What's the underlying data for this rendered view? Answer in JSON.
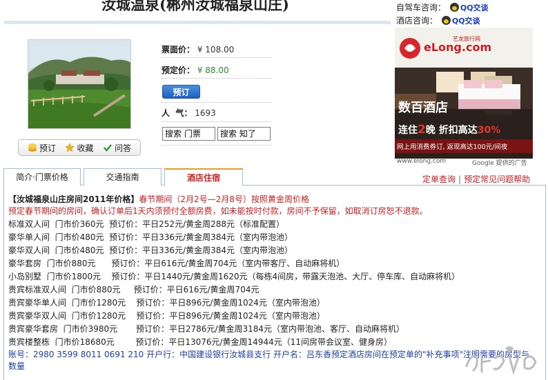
{
  "header": {
    "title": "汝城温泉(郴州汝城福泉山庄)"
  },
  "contacts": [
    {
      "label": "自驾车咨询：",
      "qq": "QQ交谈"
    },
    {
      "label": "酒店咨询：",
      "qq": "QQ交谈"
    }
  ],
  "product": {
    "price_label": "票面价：",
    "price_value": "¥ 108.00",
    "book_price_label": "预定价：",
    "book_price_value": "¥ 88.00",
    "book_button": "预订",
    "popularity_label": "人  气：",
    "popularity_value": "1693",
    "search_ticket": "搜索 门票",
    "search_zhidao": "搜索 知了"
  },
  "actions": {
    "book": "预订",
    "favorite": "收藏",
    "ask": "问答"
  },
  "ad": {
    "brand": "eLong.com",
    "brand_cn": "艺龙旅行网",
    "headline": "数百酒店",
    "promo_prefix": "连住",
    "promo_num": "2",
    "promo_mid": "晚  折扣高达",
    "promo_pct": "30%",
    "sub": "网上用消费券订, 返现高达100元/间夜",
    "caption_left": "www.elong.com",
    "caption_right": "Google 提供的广告"
  },
  "tabs": [
    {
      "label": "简介·门票价格",
      "active": false
    },
    {
      "label": "交通指南",
      "active": false
    },
    {
      "label": "酒店住宿",
      "active": true
    }
  ],
  "tab_links": {
    "query": "定单查询",
    "faq": "预定常见问题帮助"
  },
  "content": {
    "header_bold": "【汝城福泉山庄房间2011年价格】",
    "header_red": "春节期间（2月2号—2月8号）按照黄金周价格",
    "warning": "预定春节期间的房间，确认订单后1天内须预付全额房费，如未能按时付款，房间不予保留，如取消订房恕不退款。",
    "rooms": [
      "标准双人间  门市价360元  预订价：平日252元/黄金周288元（标准配置）",
      "豪华单人间  门市价480元  预订价：平日336元/黄金周384元（室内带泡池）",
      "豪华双人间  门市价480元  预订价：平日336元/黄金周384元（室内带泡池）",
      "豪华套房  门市价880元      预订价：平日616元/黄金周704元（室内带客厅、自动麻将机）",
      "小岛别墅  门市价1800元    预订价：平日1440元/黄金周1620元（每栋4间房，带露天泡池、大厅、停车库、自动麻将机）",
      "贵宾标准双人间  门市价880元     预订价：平日616元/黄金周704元",
      "贵宾豪华单人间  门市价1280元    预订价：平日896元/黄金周1024元（室内带泡池）",
      "贵宾豪华双人间  门市价1280元    预订价：平日896元/黄金周1024元（室内带泡池）",
      "贵宾豪华套房  门市价3980元       预订价：平日2786元/黄金周3184元（室内带泡池、客厅、自动麻将机）",
      "贵宾楼整栋  门市价18680元        预订价：平日13076元/黄金周14944元（11间房带会议室、健身房）"
    ],
    "account": "账号：2980 3599 8011 0691 210 开户行：中国建设银行汝城县支行  开户名：吕东香预定酒店房间在预定单的\"补充事项\"注明需要的房型与数量"
  },
  "colors": {
    "accent_red": "#d41e1e",
    "link_blue": "#1d3eb0",
    "tab_border": "#9fc0e4",
    "active_tab_top": "#f09a1a"
  }
}
